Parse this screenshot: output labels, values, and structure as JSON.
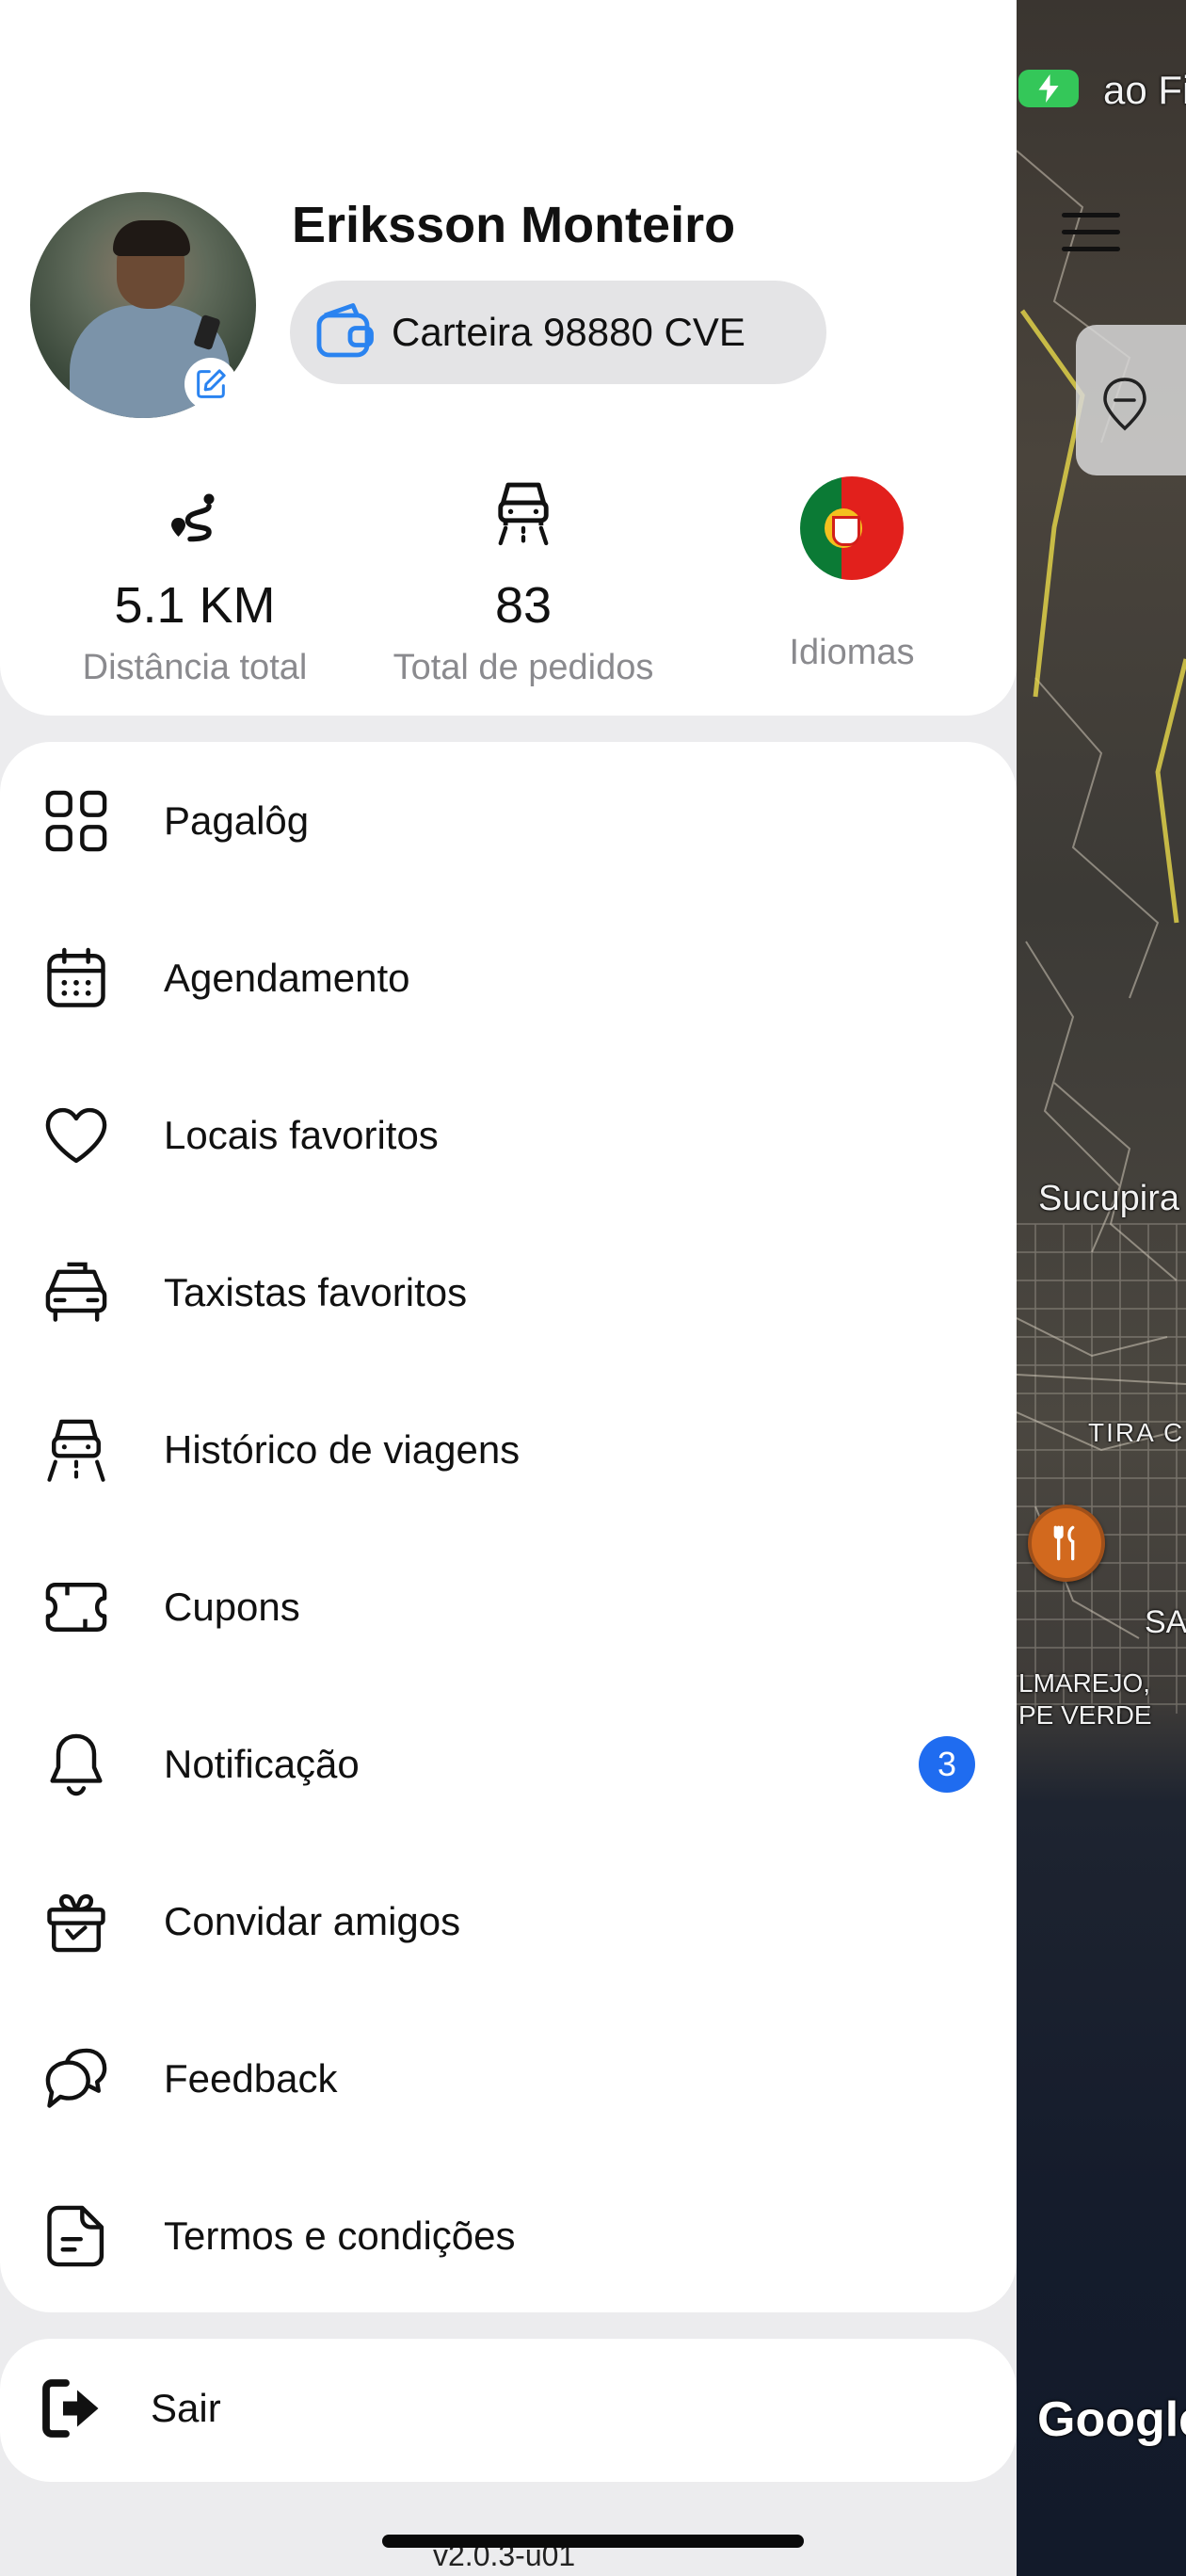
{
  "profile": {
    "name": "Eriksson Monteiro",
    "wallet_label": "Carteira 98880 CVE"
  },
  "stats": [
    {
      "value": "5.1 KM",
      "label": "Distância total",
      "icon": "route-icon"
    },
    {
      "value": "83",
      "label": "Total de pedidos",
      "icon": "car-front-icon"
    },
    {
      "value": "",
      "label": "Idiomas",
      "icon": "portugal-flag-icon"
    }
  ],
  "menu": [
    {
      "label": "Pagalôg",
      "icon": "grid-icon"
    },
    {
      "label": "Agendamento",
      "icon": "calendar-icon"
    },
    {
      "label": "Locais favoritos",
      "icon": "heart-icon"
    },
    {
      "label": "Taxistas favoritos",
      "icon": "taxi-icon"
    },
    {
      "label": "Histórico de viagens",
      "icon": "car-road-icon"
    },
    {
      "label": "Cupons",
      "icon": "ticket-icon"
    },
    {
      "label": "Notificação",
      "icon": "bell-icon",
      "badge": "3"
    },
    {
      "label": "Convidar amigos",
      "icon": "gift-icon"
    },
    {
      "label": "Feedback",
      "icon": "chat-bubbles-icon"
    },
    {
      "label": "Termos e condições",
      "icon": "document-icon"
    }
  ],
  "logout": {
    "label": "Sair",
    "icon": "logout-icon"
  },
  "version": "v2.0.3-u01",
  "map": {
    "labels": [
      "ao Fili",
      "Sucupira",
      "TIRA C",
      "SA",
      "LMAREJO,",
      "PE VERDE",
      "Google"
    ]
  },
  "colors": {
    "accent": "#1f6cf0",
    "badge": "#1f6cf0",
    "battery": "#34c759"
  }
}
